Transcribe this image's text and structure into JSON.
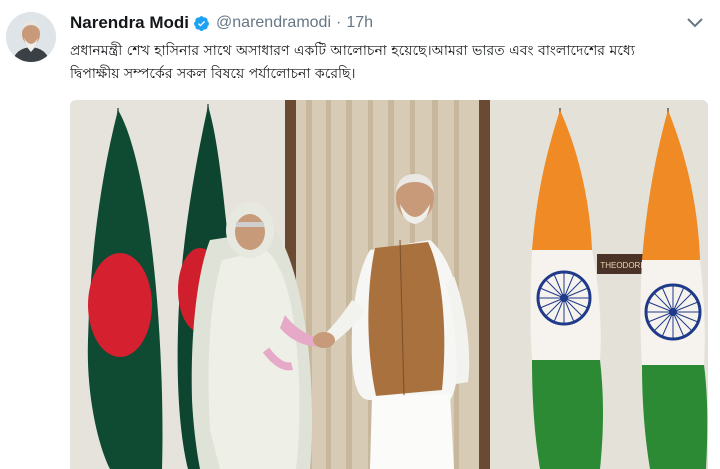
{
  "tweet": {
    "author_name": "Narendra Modi",
    "handle": "@narendramodi",
    "separator": "·",
    "time": "17h",
    "text_line1": "প্রধানমন্ত্রী শেখ হাসিনার সাথে অসাধারণ একটি আলোচনা হয়েছে।আমরা ভারত এবং বাংলাদেশের মধ্যে",
    "text_line2": "দ্বিপাক্ষীয় সম্পর্কের সকল বিষয়ে পর্যালোচনা করেছি।",
    "photo_sign_text": "THEODORE"
  },
  "icons": {
    "verified": "verified-badge-icon",
    "caret": "chevron-down-icon"
  },
  "colors": {
    "verified_blue": "#1da1f2",
    "secondary_text": "#657786",
    "bangladesh_green": "#006a4e",
    "bangladesh_red": "#f42a41",
    "india_saffron": "#ff9933",
    "india_green": "#138808",
    "chakra_blue": "#000080"
  }
}
